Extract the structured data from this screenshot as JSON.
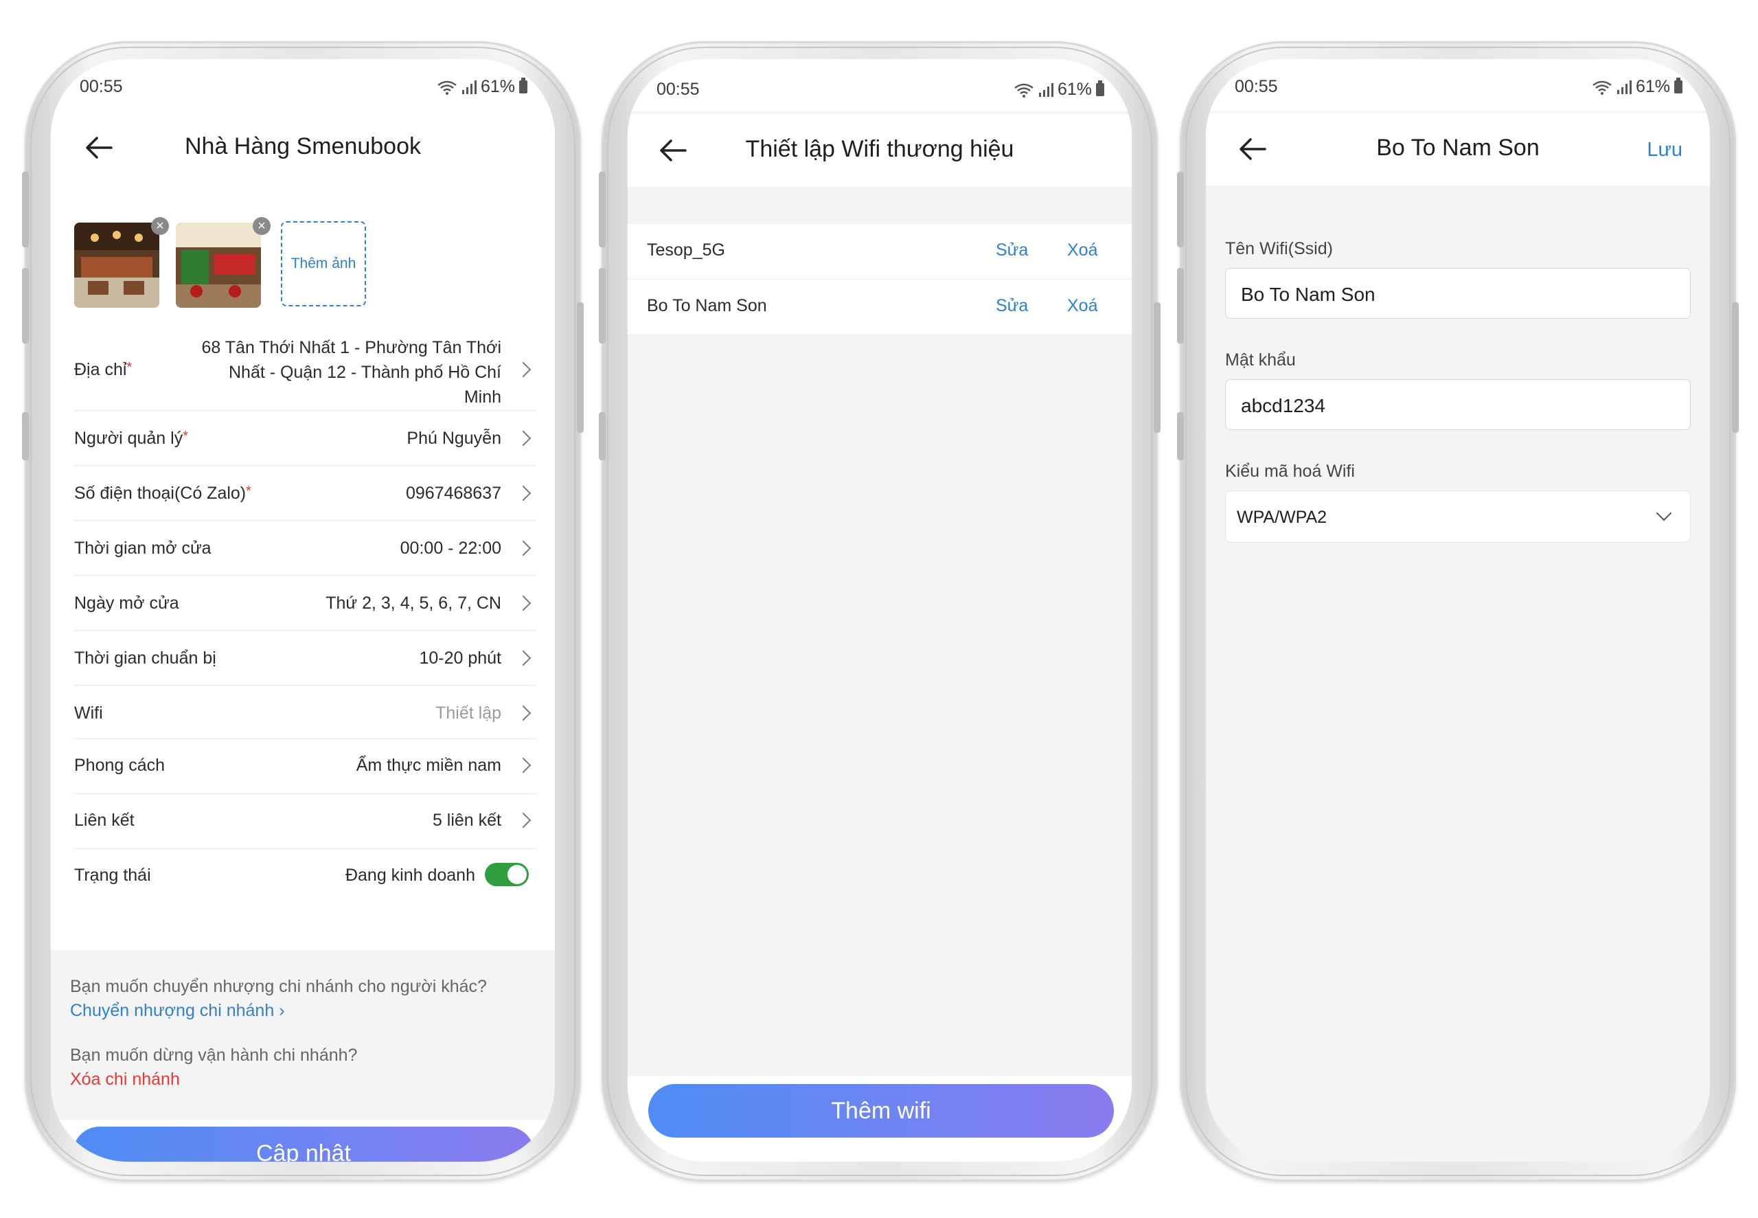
{
  "status_bar": {
    "time": "00:55",
    "battery": "61%"
  },
  "screen1": {
    "title": "Nhà Hàng Smenubook",
    "add_photo": "Thêm ảnh",
    "rows": [
      {
        "label": "Địa chỉ",
        "required": true,
        "value_lines": [
          "68 Tân Thới Nhất 1 - Phường Tân Thới",
          "Nhất - Quận 12 - Thành phố Hồ Chí",
          "Minh"
        ]
      },
      {
        "label": "Người quản lý",
        "required": true,
        "value": "Phú Nguyễn"
      },
      {
        "label": "Số điện thoại(Có Zalo)",
        "required": true,
        "value": "0967468637"
      },
      {
        "label": "Thời gian mở cửa",
        "value": "00:00 - 22:00"
      },
      {
        "label": "Ngày mở cửa",
        "value": "Thứ 2, 3, 4, 5, 6, 7, CN"
      },
      {
        "label": "Thời gian chuẩn bị",
        "value": "10-20 phút"
      },
      {
        "label": "Wifi",
        "value": "Thiết lập"
      },
      {
        "label": "Phong cách",
        "value": "Ẩm thực miền nam"
      },
      {
        "label": "Liên kết",
        "value": "5 liên kết"
      },
      {
        "label": "Trạng thái",
        "value": "Đang kinh doanh",
        "toggle_on": true
      }
    ],
    "transfer_question": "Bạn muốn chuyển nhượng chi nhánh cho người khác?",
    "transfer_link": "Chuyển nhượng chi nhánh",
    "stop_question": "Bạn muốn dừng vận hành chi nhánh?",
    "delete_link": "Xóa chi nhánh",
    "update_button": "Cập nhật",
    "required_mark": "*"
  },
  "screen2": {
    "title": "Thiết lập Wifi thương hiệu",
    "wifi_list": [
      {
        "name": "Tesop_5G",
        "edit": "Sửa",
        "delete": "Xoá"
      },
      {
        "name": "Bo To Nam Son",
        "edit": "Sửa",
        "delete": "Xoá"
      }
    ],
    "add_button": "Thêm wifi"
  },
  "screen3": {
    "title": "Bo To Nam Son",
    "save": "Lưu",
    "ssid_label": "Tên Wifi(Ssid)",
    "ssid_value": "Bo To Nam Son",
    "password_label": "Mật khẩu",
    "password_value": "abcd1234",
    "encryption_label": "Kiểu mã hoá Wifi",
    "encryption_value": "WPA/WPA2"
  },
  "colors": {
    "accent": "#2f80d1",
    "danger": "#e53935",
    "toggle": "#2e9e3e",
    "button_start": "#4e8df5",
    "button_end": "#8b7cf0"
  }
}
